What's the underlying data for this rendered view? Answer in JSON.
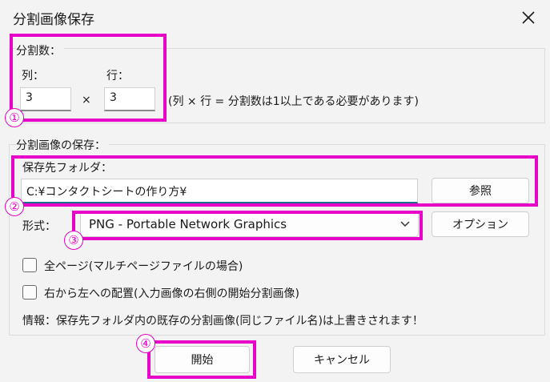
{
  "window": {
    "title": "分割画像保存"
  },
  "split_count": {
    "group_label": "分割数：",
    "columns_label": "列：",
    "columns_value": "3",
    "times": "×",
    "rows_label": "行：",
    "rows_value": "3",
    "hint": "(列 × 行 = 分割数は1以上である必要があります)"
  },
  "save": {
    "group_label": "分割画像の保存：",
    "folder_label": "保存先フォルダ：",
    "folder_value": "C:¥コンタクトシートの作り方¥",
    "browse_button": "参照",
    "format_label": "形式：",
    "format_value": "PNG - Portable Network Graphics",
    "options_button": "オプション",
    "all_pages_label": "全ページ(マルチページファイルの場合)",
    "all_pages_checked": false,
    "rtl_label": "右から左への配置(入力画像の右側の開始分割画像)",
    "rtl_checked": false,
    "info": "情報：保存先フォルダ内の既存の分割画像(同じファイル名)は上書きされます！"
  },
  "footer": {
    "start_button": "開始",
    "cancel_button": "キャンセル"
  },
  "callouts": [
    "①",
    "②",
    "③",
    "④"
  ],
  "colors": {
    "highlight": "#e600c8",
    "accent": "#1f6f8b"
  }
}
